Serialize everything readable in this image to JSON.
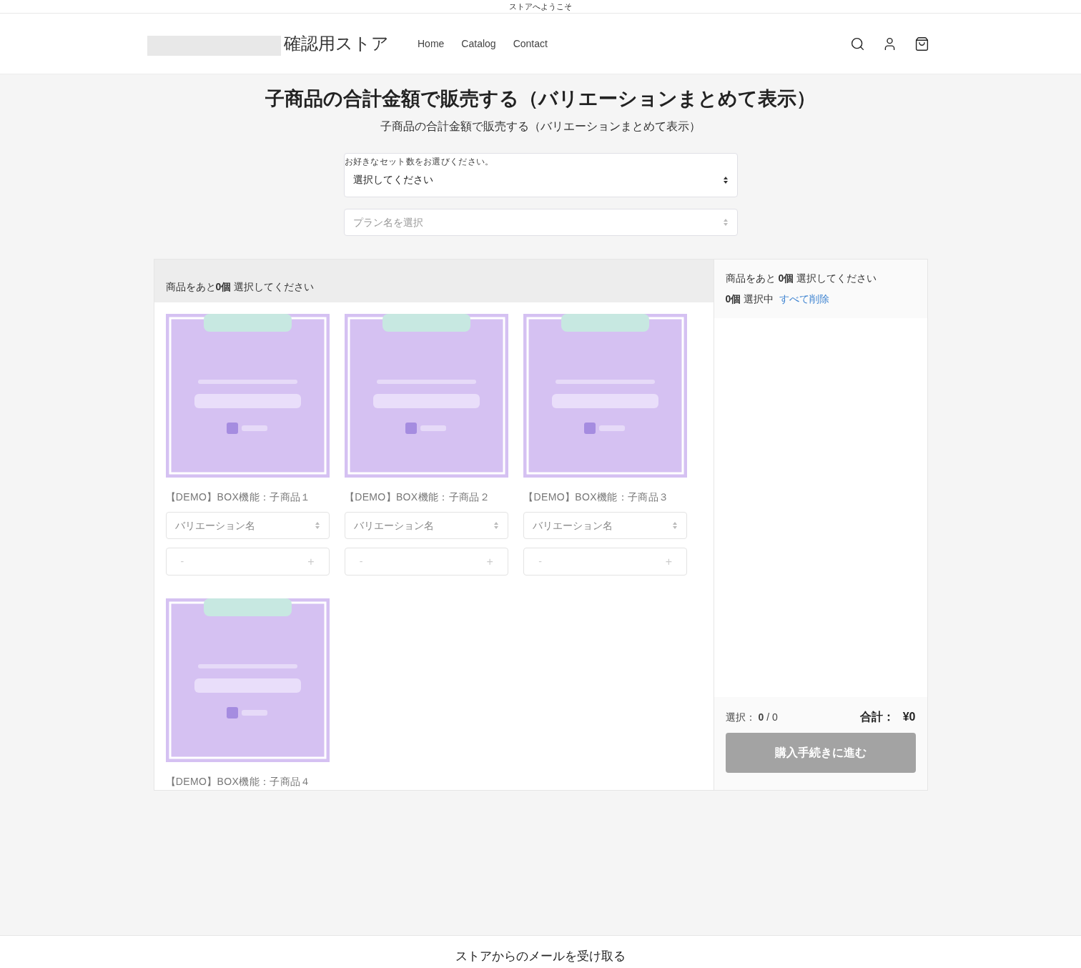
{
  "announcement": "ストアへようこそ",
  "header": {
    "logo": "確認用ストア",
    "nav": [
      {
        "label": "Home"
      },
      {
        "label": "Catalog"
      },
      {
        "label": "Contact"
      }
    ]
  },
  "page": {
    "title": "子商品の合計金額で販売する（バリエーションまとめて表示）",
    "subtitle": "子商品の合計金額で販売する（バリエーションまとめて表示）"
  },
  "set_select": {
    "label": "お好きなセット数をお選びください。",
    "value": "選択してください"
  },
  "plan_select": {
    "placeholder": "プラン名を選択"
  },
  "products_header": "商品をあと**0個** 選択してください",
  "products": [
    {
      "name": "【DEMO】BOX機能：子商品１",
      "variation_placeholder": "バリエーション名",
      "minus": "-",
      "plus": "+"
    },
    {
      "name": "【DEMO】BOX機能：子商品２",
      "variation_placeholder": "バリエーション名",
      "minus": "-",
      "plus": "+"
    },
    {
      "name": "【DEMO】BOX機能：子商品３",
      "variation_placeholder": "バリエーション名",
      "minus": "-",
      "plus": "+"
    },
    {
      "name": "【DEMO】BOX機能：子商品４"
    }
  ],
  "summary": {
    "remaining": "商品をあと **0個** 選択してください",
    "selected_count": "**0個** 選択中",
    "clear_all": "すべて削除",
    "selection_label": "選択：",
    "selection_value": "**0** / 0",
    "total_label": "合計：",
    "total": "¥0",
    "checkout": {
      "label": "購入手続きに進む",
      "disabled": true
    }
  },
  "footer": {
    "heading": "ストアからのメールを受け取る"
  }
}
